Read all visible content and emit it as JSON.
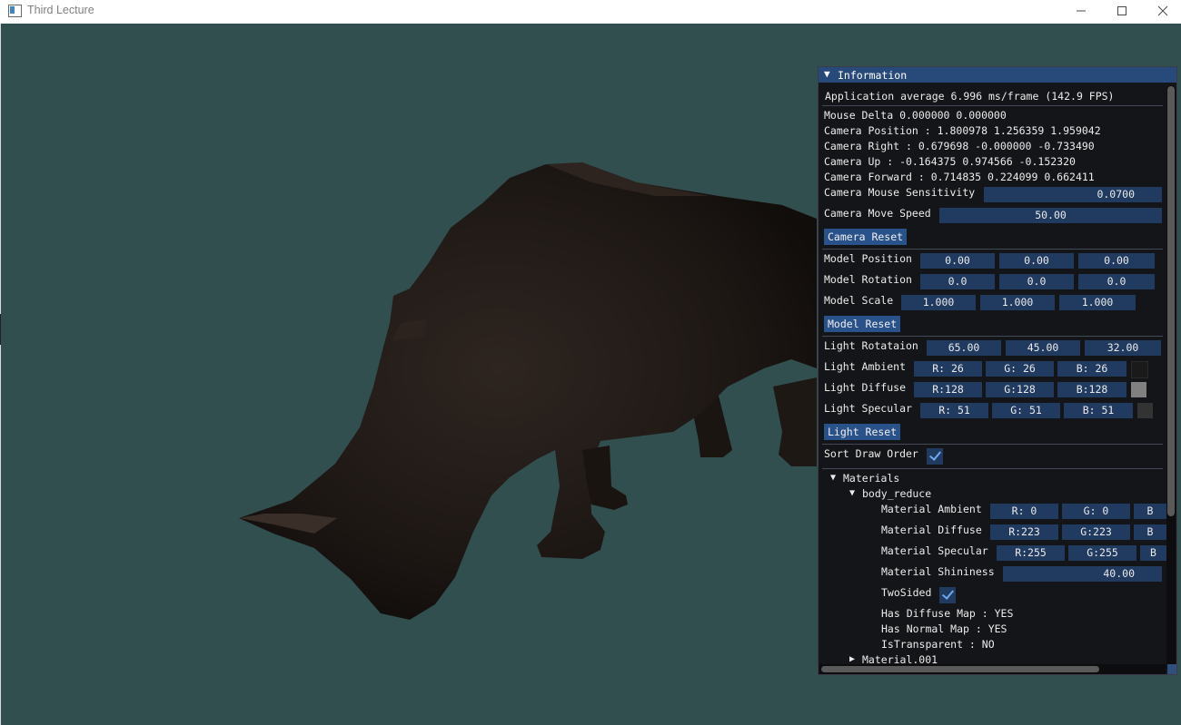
{
  "window": {
    "title": "Third Lecture",
    "minimize": "—",
    "maximize": "☐",
    "close": "✕"
  },
  "panel": {
    "title": "Information",
    "fps_line": "Application average 6.996 ms/frame (142.9 FPS)",
    "mouse_delta": "Mouse Delta 0.000000 0.000000",
    "camera_position": "Camera Position : 1.800978 1.256359 1.959042",
    "camera_right": "Camera Right : 0.679698 -0.000000 -0.733490",
    "camera_up": "Camera Up : -0.164375 0.974566 -0.152320",
    "camera_forward": "Camera Forward : 0.714835 0.224099 0.662411",
    "mouse_sensitivity_label": "Camera Mouse Sensitivity",
    "mouse_sensitivity_value": "0.0700",
    "move_speed_label": "Camera Move Speed",
    "move_speed_value": "50.00",
    "camera_reset": "Camera Reset",
    "model_position_label": "Model Position",
    "model_position": [
      "0.00",
      "0.00",
      "0.00"
    ],
    "model_rotation_label": "Model Rotation",
    "model_rotation": [
      "0.0",
      "0.0",
      "0.0"
    ],
    "model_scale_label": "Model Scale",
    "model_scale": [
      "1.000",
      "1.000",
      "1.000"
    ],
    "model_reset": "Model Reset",
    "light_rotation_label": "Light Rotataion",
    "light_rotation": [
      "65.00",
      "45.00",
      "32.00"
    ],
    "light_ambient_label": "Light Ambient",
    "light_ambient": [
      "R: 26",
      "G: 26",
      "B: 26"
    ],
    "light_ambient_color": "#1a1a1a",
    "light_diffuse_label": "Light Diffuse",
    "light_diffuse": [
      "R:128",
      "G:128",
      "B:128"
    ],
    "light_diffuse_color": "#808080",
    "light_specular_label": "Light Specular",
    "light_specular": [
      "R: 51",
      "G: 51",
      "B: 51"
    ],
    "light_specular_color": "#333333",
    "light_reset": "Light Reset",
    "sort_draw_order_label": "Sort Draw Order",
    "sort_draw_order_checked": true,
    "materials_label": "Materials",
    "material_name": "body_reduce",
    "material_ambient_label": "Material Ambient",
    "material_ambient": [
      "R:  0",
      "G:  0",
      "B"
    ],
    "material_diffuse_label": "Material Diffuse",
    "material_diffuse": [
      "R:223",
      "G:223",
      "B"
    ],
    "material_specular_label": "Material Specular",
    "material_specular": [
      "R:255",
      "G:255",
      "B"
    ],
    "material_shininess_label": "Material Shininess",
    "material_shininess_value": "40.00",
    "two_sided_label": "TwoSided",
    "two_sided_checked": true,
    "has_diffuse_map": "Has Diffuse Map : YES",
    "has_normal_map": "Has Normal Map : YES",
    "is_transparent": "IsTransparent : NO",
    "next_material": "Material.001"
  }
}
